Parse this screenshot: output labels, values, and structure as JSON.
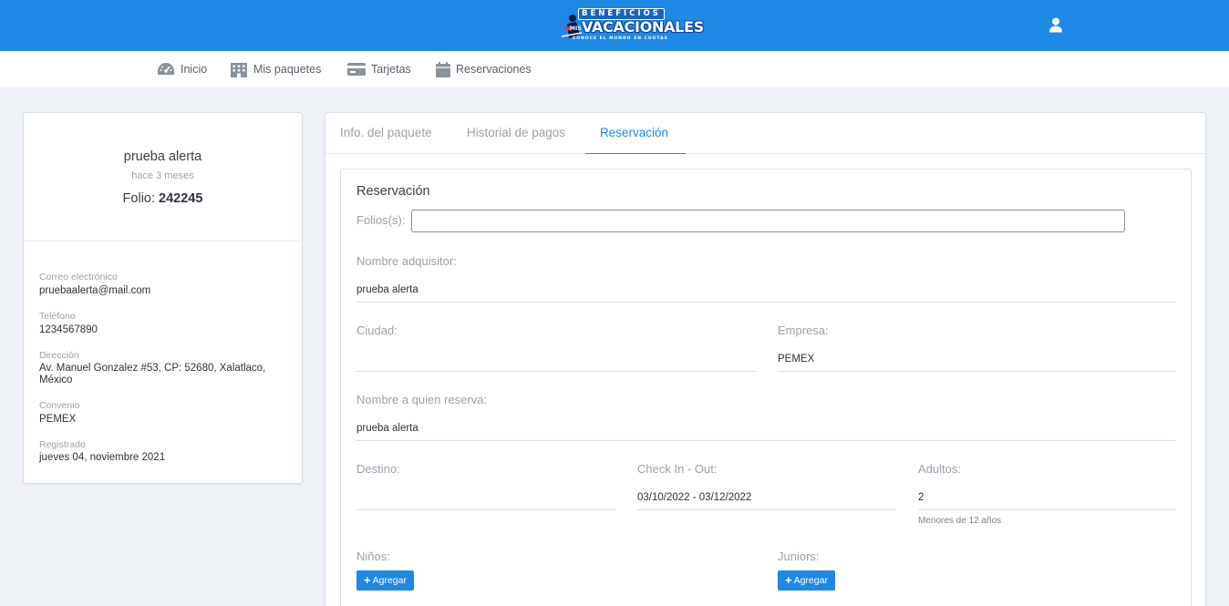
{
  "header": {
    "logo_top": "BENEFICIOS",
    "logo_mis": "MIS",
    "logo_brand": "VACACIONALES",
    "logo_tag": "CONOCE EL MUNDO EN CUOTAS",
    "brand_color": "#1e88e5"
  },
  "nav": {
    "items": [
      {
        "label": "Inicio",
        "icon": "dashboard-icon"
      },
      {
        "label": "Mis paquetes",
        "icon": "building-icon"
      },
      {
        "label": "Tarjetas",
        "icon": "credit-card-icon"
      },
      {
        "label": "Reservaciones",
        "icon": "calendar-icon"
      }
    ]
  },
  "profile": {
    "name": "prueba alerta",
    "ago": "hace 3 meses",
    "folio_label": "Folio:",
    "folio_value": "242245",
    "fields": [
      {
        "label": "Correo electrónico",
        "value": "pruebaalerta@mail.com"
      },
      {
        "label": "Teléfono",
        "value": "1234567890"
      },
      {
        "label": "Dirección",
        "value": "Av. Manuel Gonzalez #53, CP: 52680, Xalatlaco, México"
      },
      {
        "label": "Convenio",
        "value": "PEMEX"
      },
      {
        "label": "Registrado",
        "value": "jueves 04, noviembre 2021"
      }
    ]
  },
  "tabs": [
    {
      "label": "Info. del paquete",
      "active": false
    },
    {
      "label": "Historial de pagos",
      "active": false
    },
    {
      "label": "Reservación",
      "active": true
    }
  ],
  "form": {
    "title": "Reservación",
    "folios_label": "Folios(s):",
    "folios_value": "",
    "nombre_adquisitor_label": "Nombre adquisitor:",
    "nombre_adquisitor_value": "prueba alerta",
    "ciudad_label": "Ciudad:",
    "ciudad_value": "",
    "empresa_label": "Empresa:",
    "empresa_value": "PEMEX",
    "nombre_reserva_label": "Nombre a quien reserva:",
    "nombre_reserva_value": "prueba alerta",
    "destino_label": "Destino:",
    "destino_value": "",
    "checkin_label": "Check In - Out:",
    "checkin_value": "03/10/2022 - 03/12/2022",
    "adultos_label": "Adultos:",
    "adultos_value": "2",
    "adultos_hint": "Menores de 12 años",
    "ninos_label": "Niños:",
    "juniors_label": "Juniors:",
    "add_label": "Agregar"
  }
}
